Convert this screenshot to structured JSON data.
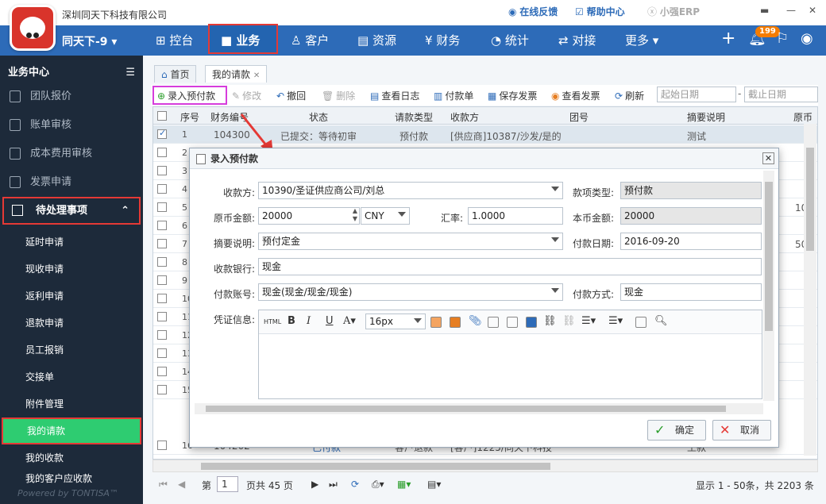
{
  "app": {
    "company_name": "深圳同天下科技有限公司",
    "username": "同天下-9",
    "links": {
      "feedback": "在线反馈",
      "help": "帮助中心",
      "brand": "小强ERP"
    },
    "notification_count": "199"
  },
  "nav": {
    "items": [
      {
        "label": "控台"
      },
      {
        "label": "业务"
      },
      {
        "label": "客户"
      },
      {
        "label": "资源"
      },
      {
        "label": "财务"
      },
      {
        "label": "统计"
      },
      {
        "label": "对接"
      },
      {
        "label": "更多"
      }
    ]
  },
  "sidebar": {
    "title": "业务中心",
    "items": [
      {
        "label": "团队报价"
      },
      {
        "label": "账单审核"
      },
      {
        "label": "成本费用审核"
      },
      {
        "label": "发票申请"
      }
    ],
    "pending": "待处理事项",
    "sub_items": [
      {
        "label": "延时申请"
      },
      {
        "label": "现收申请"
      },
      {
        "label": "返利申请"
      },
      {
        "label": "退款申请"
      },
      {
        "label": "员工报销"
      },
      {
        "label": "交接单"
      },
      {
        "label": "附件管理"
      },
      {
        "label": "我的请款"
      },
      {
        "label": "我的收款"
      },
      {
        "label": "我的客户应收款"
      }
    ],
    "powered": "Powered by TONTISA™"
  },
  "tabs": [
    {
      "label": "首页"
    },
    {
      "label": "我的请款"
    }
  ],
  "toolbar": {
    "add_prepay": "录入预付款",
    "edit": "修改",
    "revoke": "撤回",
    "delete": "删除",
    "view_log": "查看日志",
    "pay_slip": "付款单",
    "save_invoice": "保存发票",
    "view_invoice": "查看发票",
    "refresh": "刷新",
    "start_date_placeholder": "起始日期",
    "end_date_placeholder": "截止日期"
  },
  "grid": {
    "headers": [
      "序号",
      "财务编号",
      "状态",
      "请款类型",
      "收款方",
      "团号",
      "摘要说明",
      "原币金"
    ],
    "rows": [
      {
        "no": "1",
        "fin_no": "104300",
        "status": "已提交：等待初审",
        "type": "预付款",
        "payee": "[供应商]10387/沙发/是的",
        "memo": "测试",
        "selected": true
      },
      {
        "no": "2"
      },
      {
        "no": "3"
      },
      {
        "no": "4"
      },
      {
        "no": "5",
        "amount": "10"
      },
      {
        "no": "6"
      },
      {
        "no": "7",
        "amount": "50"
      },
      {
        "no": "8"
      },
      {
        "no": "9"
      },
      {
        "no": "10"
      },
      {
        "no": "11"
      },
      {
        "no": "12"
      },
      {
        "no": "13"
      },
      {
        "no": "14"
      },
      {
        "no": "15"
      },
      {
        "no": "16",
        "fin_no": "104262",
        "status": "已付款",
        "type": "客户退款",
        "payee": "[客户]1225/同天下科技",
        "memo": "王款"
      }
    ]
  },
  "pager": {
    "page_label": "第",
    "page_value": "1",
    "total_pages": "页共 45 页",
    "summary": "显示 1 - 50条，共 2203 条"
  },
  "dialog": {
    "title": "录入预付款",
    "fields": {
      "payee_label": "收款方:",
      "payee_value": "10390/圣证供应商公司/刘总",
      "fund_type_label": "款项类型:",
      "fund_type_value": "预付款",
      "orig_amount_label": "原币金额:",
      "orig_amount_value": "20000",
      "currency_value": "CNY",
      "rate_label": "汇率:",
      "rate_value": "1.0000",
      "local_amount_label": "本币金额:",
      "local_amount_value": "20000",
      "memo_label": "摘要说明:",
      "memo_value": "预付定金",
      "pay_date_label": "付款日期:",
      "pay_date_value": "2016-09-20",
      "bank_label": "收款银行:",
      "bank_value": "现金",
      "account_label": "付款账号:",
      "account_value": "现金(现金/现金/现金)",
      "pay_method_label": "付款方式:",
      "pay_method_value": "现金",
      "voucher_label": "凭证信息:"
    },
    "editor": {
      "html": "HTML",
      "bold": "B",
      "italic": "I",
      "underline": "U",
      "font_color": "A",
      "font_size": "16px"
    },
    "ok": "确定",
    "cancel": "取消"
  }
}
